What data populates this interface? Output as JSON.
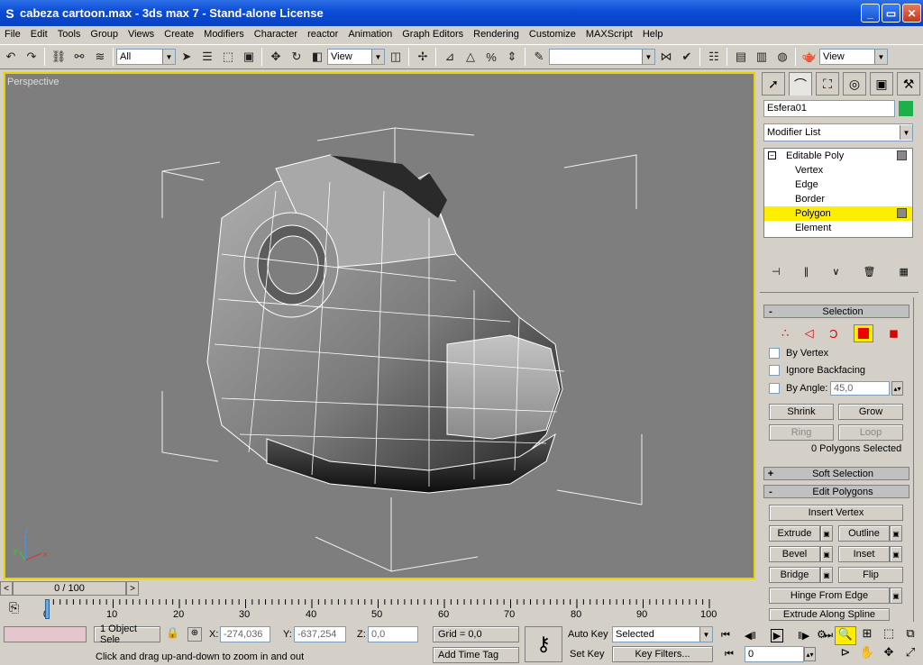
{
  "window": {
    "title": "cabeza cartoon.max - 3ds max 7  - Stand-alone License"
  },
  "menu": [
    "File",
    "Edit",
    "Tools",
    "Group",
    "Views",
    "Create",
    "Modifiers",
    "Character",
    "reactor",
    "Animation",
    "Graph Editors",
    "Rendering",
    "Customize",
    "MAXScript",
    "Help"
  ],
  "toolbar": {
    "selection_filter": "All",
    "ref_coord": "View",
    "named_selection": "",
    "view_right": "View"
  },
  "viewport": {
    "label": "Perspective",
    "axes": {
      "x": "x",
      "y": "y",
      "z": "z"
    }
  },
  "timeslider": {
    "label": "0 / 100",
    "prev": "<",
    "next": ">"
  },
  "trackbar": {
    "ticks": [
      "0",
      "10",
      "20",
      "30",
      "40",
      "50",
      "60",
      "70",
      "80",
      "90",
      "100"
    ]
  },
  "panel": {
    "object_name": "Esfera01",
    "object_color": "#1bb04a",
    "modifier_list": "Modifier List",
    "stack": {
      "root": "Editable Poly",
      "items": [
        "Vertex",
        "Edge",
        "Border",
        "Polygon",
        "Element"
      ],
      "selected": "Polygon"
    },
    "selection": {
      "title": "Selection",
      "by_vertex": "By Vertex",
      "ignore_backfacing": "Ignore Backfacing",
      "by_angle": "By Angle:",
      "angle_value": "45,0",
      "shrink": "Shrink",
      "grow": "Grow",
      "ring": "Ring",
      "loop": "Loop",
      "status": "0 Polygons Selected"
    },
    "soft_selection": "Soft Selection",
    "edit_polygons": {
      "title": "Edit Polygons",
      "insert_vertex": "Insert Vertex",
      "extrude": "Extrude",
      "outline": "Outline",
      "bevel": "Bevel",
      "inset": "Inset",
      "bridge": "Bridge",
      "flip": "Flip",
      "hinge": "Hinge From Edge",
      "extrude_spline": "Extrude Along Spline"
    }
  },
  "status": {
    "selection": "1 Object Sele",
    "x_label": "X:",
    "x_value": "-274,036",
    "y_label": "Y:",
    "y_value": "-637,254",
    "z_label": "Z:",
    "z_value": "0,0",
    "grid": "Grid = 0,0",
    "prompt": "Click and drag up-and-down to zoom in and out",
    "add_time_tag": "Add Time Tag",
    "auto_key": "Auto Key",
    "set_key": "Set Key",
    "key_mode": "Selected",
    "key_filters": "Key Filters...",
    "frame": "0"
  }
}
